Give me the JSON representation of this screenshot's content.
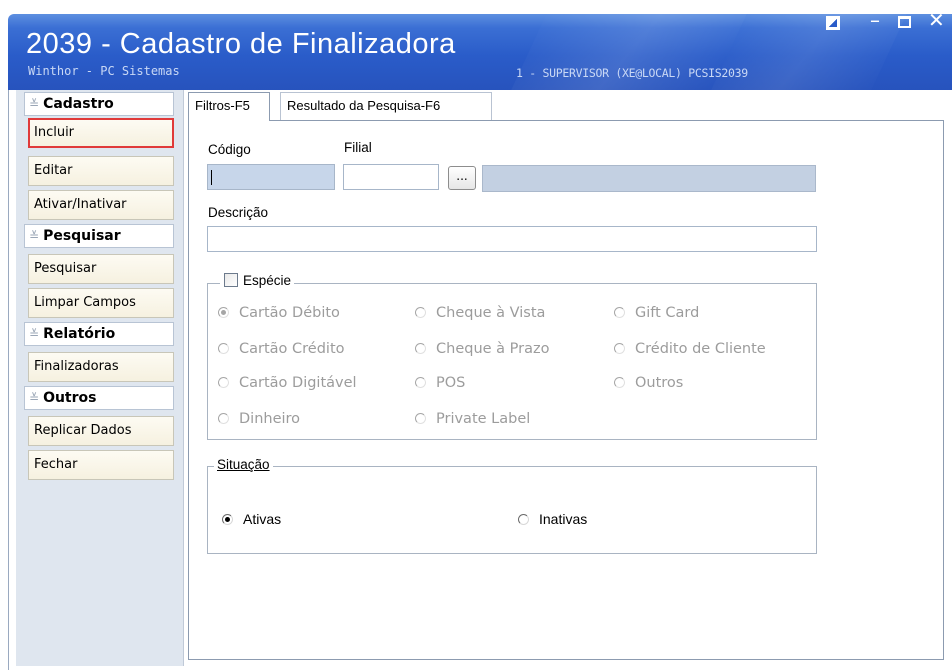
{
  "window": {
    "title": "2039 - Cadastro de Finalizadora",
    "subtitle": "Winthor - PC Sistemas",
    "user_info": "1 - SUPERVISOR (XE@LOCAL)  PCSIS2039",
    "controls": {
      "custom_icon": "restore-custom-icon",
      "minimize": "–",
      "maximize_icon": "maximize-icon",
      "close": "✕"
    }
  },
  "sidebar": {
    "cadastro": {
      "title": "Cadastro",
      "items": [
        "Incluir",
        "Editar",
        "Ativar/Inativar"
      ]
    },
    "pesquisar": {
      "title": "Pesquisar",
      "items": [
        "Pesquisar",
        "Limpar Campos"
      ]
    },
    "relatorio": {
      "title": "Relatório",
      "items": [
        "Finalizadoras"
      ]
    },
    "outros": {
      "title": "Outros",
      "items": [
        "Replicar Dados",
        "Fechar"
      ]
    }
  },
  "tabs": [
    {
      "label": "Filtros-F5",
      "active": true
    },
    {
      "label": "Resultado da Pesquisa-F6",
      "active": false
    }
  ],
  "form": {
    "codigo_label": "Código",
    "codigo_value": "",
    "filial_label": "Filial",
    "filial_value": "",
    "filial_button": "...",
    "descricao_label": "Descrição",
    "descricao_value": "",
    "especie": {
      "legend": "Espécie",
      "checked": false,
      "options": [
        "Cartão Débito",
        "Cheque à Vista",
        "Gift Card",
        "Cartão Crédito",
        "Cheque à Prazo",
        "Crédito de Cliente",
        "Cartão Digitável",
        "POS",
        "Outros",
        "Dinheiro",
        "Private Label"
      ],
      "selected": "Cartão Débito"
    },
    "situacao": {
      "legend": "Situação",
      "options": [
        "Ativas",
        "Inativas"
      ],
      "selected": "Ativas"
    }
  },
  "colors": {
    "title_bar": "#2a5cc9",
    "highlight": "#e03a3a",
    "sidebar_bg": "#dfe6ef"
  }
}
